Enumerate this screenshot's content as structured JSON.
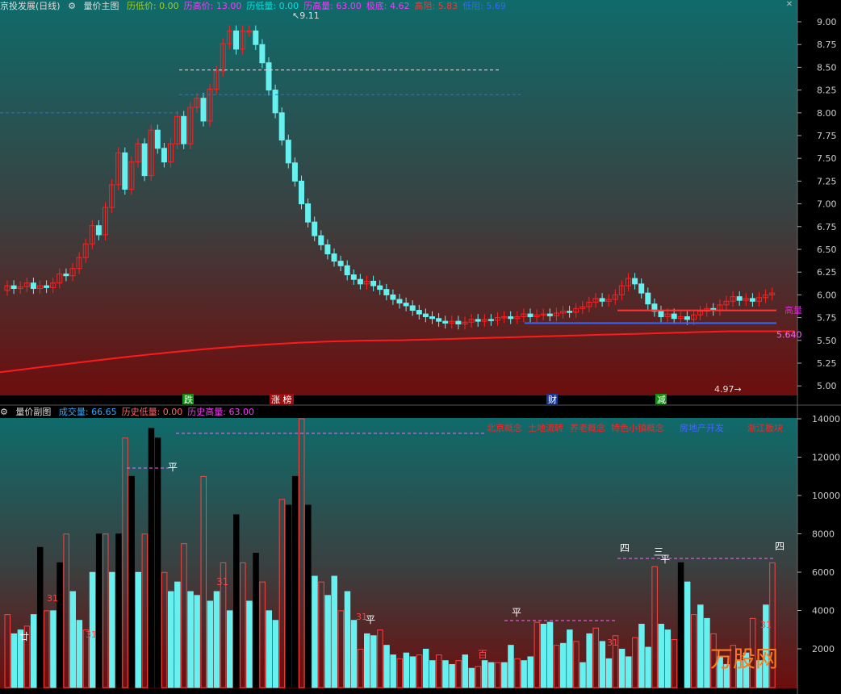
{
  "main_panel": {
    "stock_title": "京投发展(日线)",
    "panel_name": "量价主图",
    "stats": [
      {
        "label": "历低价:",
        "value": "0.00",
        "color": "#9acd32"
      },
      {
        "label": "历高价:",
        "value": "13.00",
        "color": "#ff33ff"
      },
      {
        "label": "历低量:",
        "value": "0.00",
        "color": "#00e0e0"
      },
      {
        "label": "历高量:",
        "value": "63.00",
        "color": "#ff33ff"
      },
      {
        "label": "极底:",
        "value": "4.62",
        "color": "#ff33ff"
      },
      {
        "label": "高阻:",
        "value": "5.83",
        "color": "#ff3333"
      },
      {
        "label": "低阻:",
        "value": "5.69",
        "color": "#3366ff"
      }
    ],
    "price_axis": [
      "9.00",
      "8.75",
      "8.50",
      "8.25",
      "8.00",
      "7.75",
      "7.50",
      "7.25",
      "7.00",
      "6.75",
      "6.50",
      "6.25",
      "6.00",
      "5.75",
      "5.50",
      "5.25",
      "5.00"
    ],
    "labels": {
      "high": "9.11",
      "low": "4.97",
      "right_top": "高量",
      "right_val": "5.640"
    },
    "tags": [
      {
        "text": "跌",
        "bg": "#1a8a1a"
      },
      {
        "text": "涨 榜",
        "bg": "#9a1010"
      },
      {
        "text": "财",
        "bg": "#1a3a9a"
      },
      {
        "text": "减",
        "bg": "#1a8a1a"
      }
    ]
  },
  "sub_panel": {
    "panel_name": "量价副图",
    "stats": [
      {
        "label": "成交量:",
        "value": "66.65",
        "color": "#33aaff"
      },
      {
        "label": "历史低量:",
        "value": "0.00",
        "color": "#ff6666"
      },
      {
        "label": "历史高量:",
        "value": "63.00",
        "color": "#ff33ff"
      }
    ],
    "vol_axis": [
      "14000",
      "12000",
      "10000",
      "8000",
      "6000",
      "4000",
      "2000"
    ],
    "concepts": [
      {
        "text": "北京概念",
        "color": "#ff2222"
      },
      {
        "text": "土地流转",
        "color": "#ff2222"
      },
      {
        "text": "养老概念",
        "color": "#ff2222"
      },
      {
        "text": "特色小镇概念",
        "color": "#ff2222"
      },
      {
        "text": "房地产开发",
        "color": "#4466ff"
      },
      {
        "text": "浙江板块",
        "color": "#ff2222"
      }
    ],
    "marks": [
      "平",
      "平",
      "平",
      "平",
      "四",
      "三",
      "四",
      "廿",
      "31",
      "百"
    ],
    "brand": "万股网"
  },
  "colors": {
    "up_candle": "#ff2020",
    "down_candle": "#66f0f0",
    "ma_line": "#ff1a1a",
    "resist_high": "#ff3333",
    "resist_low": "#3366ff"
  }
}
